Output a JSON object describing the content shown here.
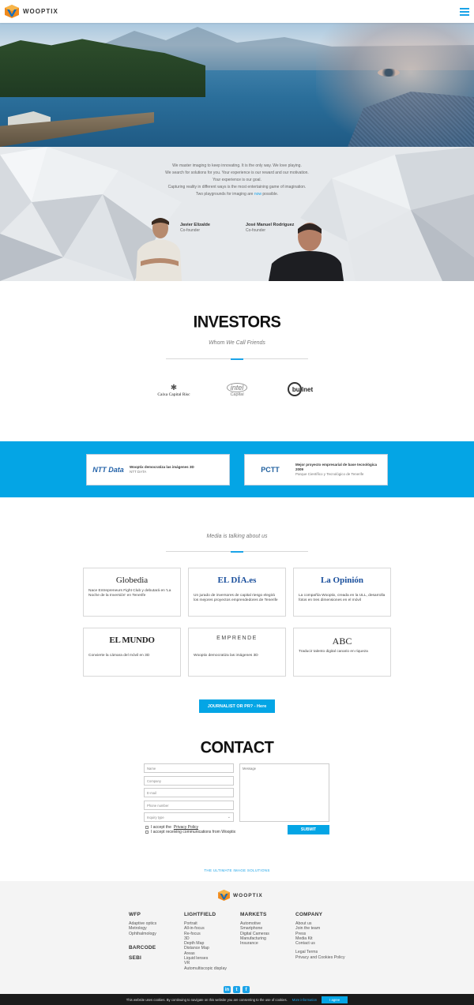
{
  "header": {
    "brand": "WOOPTIX"
  },
  "team": {
    "paragraph": [
      "We master imaging to keep innovating. It is the only way. We love playing.",
      "We search for solutions for you. Your experience is our reward and our motivation.",
      "Your experience is our goal.",
      "Capturing reality in different ways is the most entertaining game of imagination."
    ],
    "last_line_pre": "Two playgrounds for imaging are",
    "last_line_link": "now",
    "last_line_post": "possible.",
    "people": [
      {
        "name": "Javier Elizalde",
        "role": "Co-founder"
      },
      {
        "name": "José Manuel Rodríguez",
        "role": "Co-founder"
      }
    ]
  },
  "investors": {
    "title": "INVESTORS",
    "subtitle": "Whom We Call Friends",
    "logos": [
      {
        "name": "Caixa Capital Risc"
      },
      {
        "name": "intel",
        "sub": "Capital"
      },
      {
        "name": "bullnet"
      }
    ]
  },
  "awards": [
    {
      "brand": "NTT Data",
      "title": "Wooptix democratiza las imágenes 3D",
      "source": "NTT DATA"
    },
    {
      "brand": "PCTT",
      "title": "Mejor proyecto empresarial de base tecnológica 2009",
      "source": "Parque Científico y Tecnológico de Tenerife"
    }
  ],
  "media": {
    "subtitle": "Media is talking about us",
    "cards": [
      {
        "logo": "Globedia",
        "text": "Nace Entrepreneurs Fight Club y debutará en 'La Noche de la Inversión' en Tenerife"
      },
      {
        "logo": "EL DÍA.es",
        "text": "Un jurado de inversores de capital riesgo elegirá los mejores proyectos emprendedores de Tenerife"
      },
      {
        "logo": "La Opinión",
        "text": "La compañía Wooptix, creada en la ULL, desarrolla fotos en tres dimensiones en el móvil"
      },
      {
        "logo": "EL MUNDO",
        "text": "Convierte la cámara del móvil en 3D"
      },
      {
        "logo": "EMPRENDE",
        "text": "Wooptix democratiza las imágenes 3D"
      },
      {
        "logo": "ABC",
        "text": "Traducir talento digital canario en riqueza"
      }
    ],
    "journalist_button": "JOURNALIST OR PR? - Here"
  },
  "contact": {
    "title": "CONTACT",
    "placeholders": {
      "name": "Name",
      "company": "Company",
      "email": "E-mail",
      "phone": "Phone number",
      "inquiry": "Inquiry type",
      "message": "Message"
    },
    "accept_privacy_pre": "I accept the",
    "accept_privacy_link": "Privacy Policy",
    "accept_comms": "I accept receiving communications from Wooptix",
    "submit": "SUBMIT"
  },
  "tagline": "THE ULTIMATE IMAGE SOLUTIONS",
  "footer": {
    "brand": "WOOPTIX",
    "columns": [
      {
        "head": "WFP",
        "items": [
          "Adaptive optics",
          "Metrology",
          "Ophthalmology"
        ],
        "extra_heads": [
          "BARCODE",
          "SEBI"
        ]
      },
      {
        "head": "LIGHTFIELD",
        "items": [
          "Portrait",
          "All-in-focus",
          "Re-focus",
          "3D",
          "Depth Map",
          "Distance Map",
          "Areas",
          "Liquid lenses",
          "VR",
          "Automultiscopic display"
        ]
      },
      {
        "head": "MARKETS",
        "items": [
          "Automotive",
          "Smartphone",
          "Digital Cameras",
          "Manufacturing",
          "Insurance"
        ]
      },
      {
        "head": "COMPANY",
        "items": [
          "About us",
          "Join the team",
          "Press",
          "Media Kit",
          "Contact us"
        ],
        "legal": [
          "Legal Terms",
          "Privacy and Cookies Policy"
        ]
      }
    ]
  },
  "cookie": {
    "text": "This website uses cookies. By continuing to navigate on this website you are consenting to the use of cookies.",
    "more": "More information",
    "agree": "I agree"
  },
  "colors": {
    "accent": "#04a5e5",
    "link": "#1aa3e8"
  }
}
